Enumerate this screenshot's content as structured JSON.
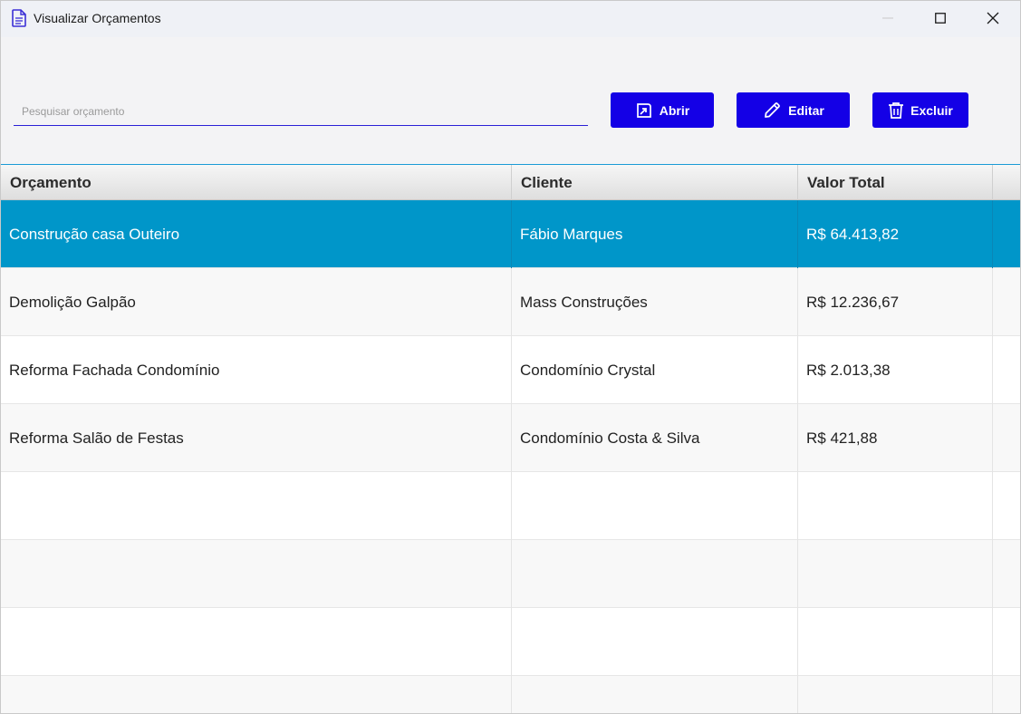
{
  "window": {
    "title": "Visualizar Orçamentos",
    "app_icon": "document-icon"
  },
  "toolbar": {
    "search_placeholder": "Pesquisar orçamento",
    "search_value": "",
    "open_label": "Abrir",
    "edit_label": "Editar",
    "delete_label": "Excluir",
    "accent_color": "#1400e6"
  },
  "table": {
    "columns": [
      "Orçamento",
      "Cliente",
      "Valor Total"
    ],
    "rows": [
      {
        "orcamento": "Construção casa Outeiro",
        "cliente": "Fábio Marques",
        "valor": "R$ 64.413,82",
        "selected": true
      },
      {
        "orcamento": "Demolição Galpão",
        "cliente": "Mass Construções",
        "valor": "R$ 12.236,67",
        "selected": false
      },
      {
        "orcamento": "Reforma Fachada Condomínio",
        "cliente": "Condomínio Crystal",
        "valor": "R$ 2.013,38",
        "selected": false
      },
      {
        "orcamento": "Reforma Salão de Festas",
        "cliente": "Condomínio Costa & Silva",
        "valor": "R$ 421,88",
        "selected": false
      }
    ],
    "selection_color": "#0096c9"
  }
}
